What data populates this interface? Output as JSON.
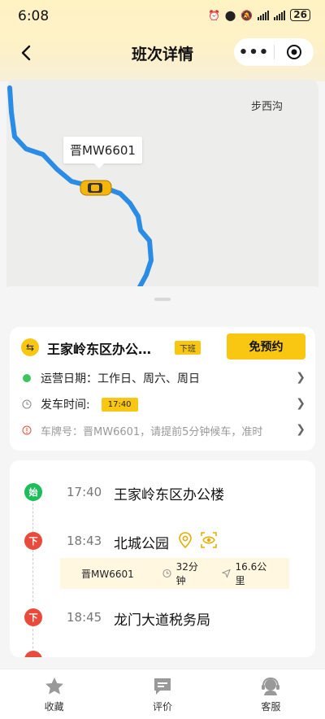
{
  "status_bar": {
    "time": "6:08",
    "battery": "26"
  },
  "header": {
    "title": "班次详情",
    "more_icon": "more-dots-icon",
    "record_icon": "record-circle-icon"
  },
  "map": {
    "poi_label": "步西沟",
    "vehicle_label": "晋MW6601",
    "route_color": "#2b8ce6"
  },
  "route_card": {
    "name": "王家岭东区办公…",
    "tag": "下班",
    "reserve_label": "免预约",
    "operating_label": "运营日期：工作日、周六、周日",
    "depart_label": "发车时间:",
    "depart_time": "17:40",
    "plate_notice": "车牌号：晋MW6601，请提前5分钟候车，准时"
  },
  "stops": [
    {
      "badge": "始",
      "time": "17:40",
      "name": "王家岭东区办公楼"
    },
    {
      "badge": "下",
      "time": "18:43",
      "name": "北城公园"
    },
    {
      "badge": "下",
      "time": "18:45",
      "name": "龙门大道税务局"
    }
  ],
  "trip_info": {
    "plate": "晋MW6601",
    "duration": "32分钟",
    "distance": "16.6公里"
  },
  "tabbar": {
    "items": [
      {
        "label": "收藏"
      },
      {
        "label": "评价"
      },
      {
        "label": "客服"
      }
    ]
  },
  "colors": {
    "accent": "#f9c712",
    "start_green": "#1dbd5a",
    "stop_red": "#e84b3c"
  }
}
